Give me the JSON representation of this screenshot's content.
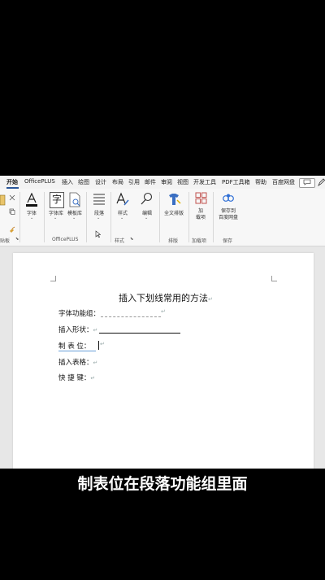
{
  "tabs": [
    "开始",
    "OfficePLUS",
    "插入",
    "绘图",
    "设计",
    "布局",
    "引用",
    "邮件",
    "审阅",
    "视图",
    "开发工具",
    "PDF工具箱",
    "帮助",
    "百度网盘"
  ],
  "ribbon": {
    "font_label": "字体",
    "font_lib_label": "字体库",
    "template_lib_label": "模板库",
    "paragraph_label": "段落",
    "styles_label": "样式",
    "edit_label": "编辑",
    "full_layout_label": "全文排版",
    "addins_label": "加\n载项",
    "save_baidu_label": "保存到\n百度网盘",
    "group_clipboard": "贴板",
    "group_officeplus": "OfficePLUS",
    "group_styles": "样式",
    "group_layout": "排版",
    "group_addins": "加载项",
    "group_save": "保存"
  },
  "document": {
    "title": "插入下划线常用的方法",
    "lines": [
      {
        "label": "字体功能组：",
        "style": "dotted"
      },
      {
        "label": "插入形状：",
        "style": "solid"
      },
      {
        "label": "制 表 位：",
        "style": "cursor"
      },
      {
        "label": "插入表格：",
        "style": "none"
      },
      {
        "label": "快 捷 键：",
        "style": "none"
      }
    ],
    "para_mark": "↵"
  },
  "subtitle": "制表位在段落功能组里面"
}
